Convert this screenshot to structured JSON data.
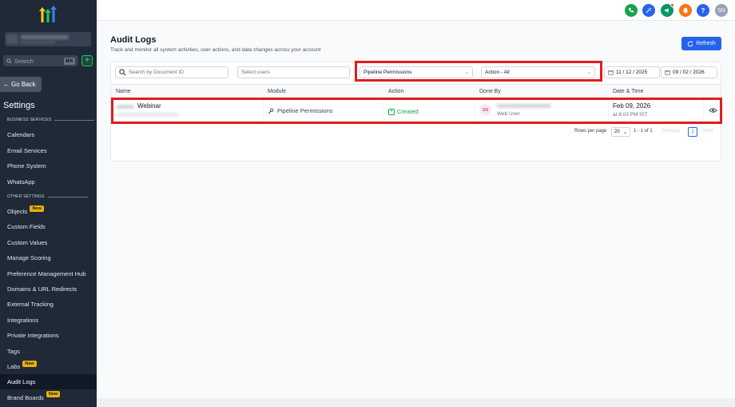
{
  "sidebar": {
    "search_placeholder": "Search",
    "search_shortcut": "⌘K",
    "add_symbol": "+",
    "go_back": "Go Back",
    "settings_title": "Settings",
    "section_business": "BUSINESS SERVICES",
    "section_other": "OTHER SETTINGS",
    "new_badge": "New",
    "business_items": [
      "Calendars",
      "Email Services",
      "Phone System",
      "WhatsApp"
    ],
    "other_items": [
      {
        "label": "Objects",
        "new": true
      },
      {
        "label": "Custom Fields",
        "new": false
      },
      {
        "label": "Custom Values",
        "new": false
      },
      {
        "label": "Manage Scoring",
        "new": false
      },
      {
        "label": "Preference Management Hub",
        "new": false
      },
      {
        "label": "Domains & URL Redirects",
        "new": false
      },
      {
        "label": "External Tracking",
        "new": false
      },
      {
        "label": "Integrations",
        "new": false
      },
      {
        "label": "Private Integrations",
        "new": false
      },
      {
        "label": "Tags",
        "new": false
      },
      {
        "label": "Labs",
        "new": true
      },
      {
        "label": "Audit Logs",
        "new": false,
        "active": true
      },
      {
        "label": "Brand Boards",
        "new": true
      }
    ]
  },
  "topbar": {
    "avatar_initials": "SN",
    "help_symbol": "?",
    "colors": {
      "phone": "#16a34a",
      "magic": "#2563eb",
      "megaphone": "#059669",
      "bell": "#f97316",
      "help": "#2563eb",
      "avatar": "#94a3b8"
    }
  },
  "page": {
    "title": "Audit Logs",
    "subtitle": "Track and monitor all system activities, user actions, and data changes across your account",
    "refresh_label": "Refresh"
  },
  "filters": {
    "search_placeholder": "Search by Document ID",
    "users_placeholder": "Select users",
    "module_value": "Pipeline Permissions",
    "action_value": "Action - All",
    "date_from": "11 / 12 / 2025",
    "date_to": "09 / 02 / 2026"
  },
  "table": {
    "headers": {
      "name": "Name",
      "module": "Module",
      "action": "Action",
      "done_by": "Done By",
      "date_time": "Date & Time"
    },
    "rows": [
      {
        "name": "Webinar",
        "module": "Pipeline Permissions",
        "action": "Created",
        "done_by_initials": "SN",
        "done_by_role": "Web User",
        "date": "Feb 09, 2026",
        "time": "at 8:03 PM IST"
      }
    ]
  },
  "pagination": {
    "rows_per_page_label": "Rows per page",
    "rows_per_page_value": "20",
    "range": "1 - 1 of 1",
    "previous": "Previous",
    "current_page": "1",
    "next": "Next"
  },
  "accent_color": "#2563eb",
  "highlight_color": "#e11d1d"
}
